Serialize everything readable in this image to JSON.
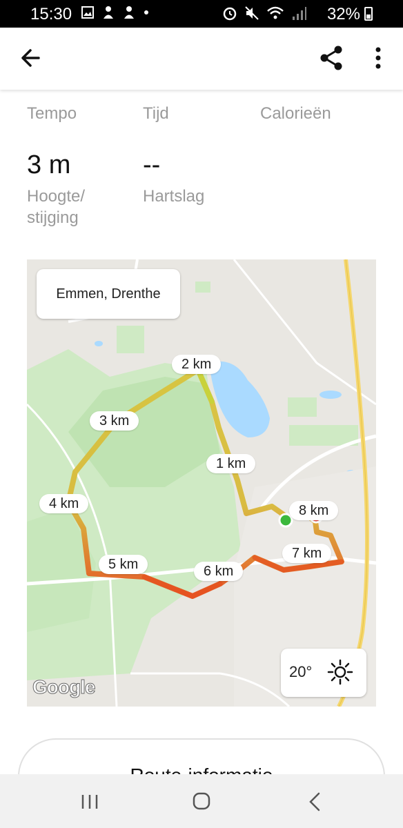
{
  "status_bar": {
    "time": "15:30",
    "battery_percent": "32%"
  },
  "app_bar": {
    "back_icon": "arrow-left-icon",
    "share_icon": "share-icon",
    "more_icon": "more-vertical-icon"
  },
  "stats": {
    "row1": [
      {
        "label": "Tempo"
      },
      {
        "label": "Tijd"
      },
      {
        "label": "Calorieën"
      }
    ],
    "row2": [
      {
        "value": "3 m",
        "label_line1": "Hoogte/",
        "label_line2": "stijging"
      },
      {
        "value": "--",
        "label_line1": "Hartslag"
      }
    ]
  },
  "map": {
    "location": "Emmen, Drenthe",
    "km_markers": [
      "1 km",
      "2 km",
      "3 km",
      "4 km",
      "5 km",
      "6 km",
      "7 km",
      "8 km"
    ],
    "weather_temp": "20°",
    "weather_icon": "sun-icon",
    "attribution": "Google",
    "colors": {
      "map_bg": "#e9e7e2",
      "park": "#cfeac4",
      "water": "#aadaff",
      "highway": "#f5d76e",
      "route_start": "#d4c23a",
      "route_hot": "#e6501e",
      "start_marker": "#3cb83c",
      "end_marker": "#e53935"
    }
  },
  "route_button": {
    "label": "Route-informatie"
  },
  "nav_bar": {
    "recents_icon": "recents-icon",
    "home_icon": "home-icon",
    "back_icon": "back-chevron-icon"
  }
}
